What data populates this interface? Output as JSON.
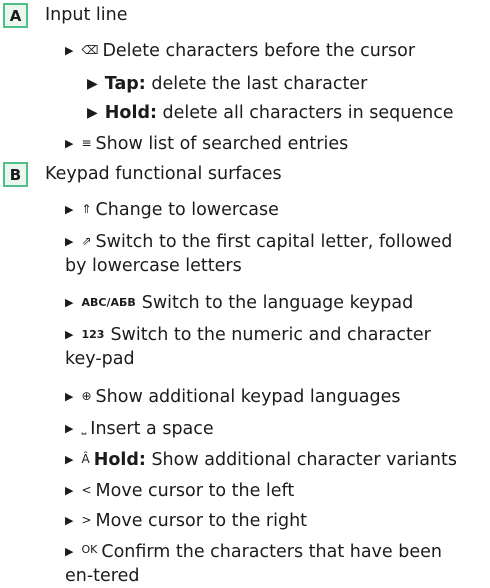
{
  "section_a": {
    "letter": "A",
    "title": "Input line",
    "items": [
      {
        "icon": "⌫",
        "text": "Delete characters before the cursor"
      },
      {
        "label": "Tap:",
        "text": " delete the last character"
      },
      {
        "label": "Hold:",
        "text": " delete all characters in sequence"
      },
      {
        "icon": "≡",
        "text": "Show list of searched entries"
      }
    ]
  },
  "section_b": {
    "letter": "B",
    "title": "Keypad functional surfaces",
    "items": [
      {
        "icon": "⇑",
        "text": "Change to lowercase"
      },
      {
        "icon": "⇗",
        "text": "Switch to the first capital letter, followed by lowercase letters"
      },
      {
        "icon": "ABC/АБВ",
        "text": "Switch to the language keypad"
      },
      {
        "icon": "123",
        "text": "Switch to the numeric and character key-pad"
      },
      {
        "icon": "⊕",
        "text": "Show additional keypad languages"
      },
      {
        "icon": "⎵",
        "text": "Insert a space"
      },
      {
        "icon": "Â",
        "label": "Hold:",
        "text": " Show additional character variants"
      },
      {
        "icon": "<",
        "text": "Move cursor to the left"
      },
      {
        "icon": ">",
        "text": "Move cursor to the right"
      },
      {
        "icon": "OK",
        "text": "Confirm the characters that have been en-tered"
      }
    ]
  },
  "list_marker": "▶"
}
